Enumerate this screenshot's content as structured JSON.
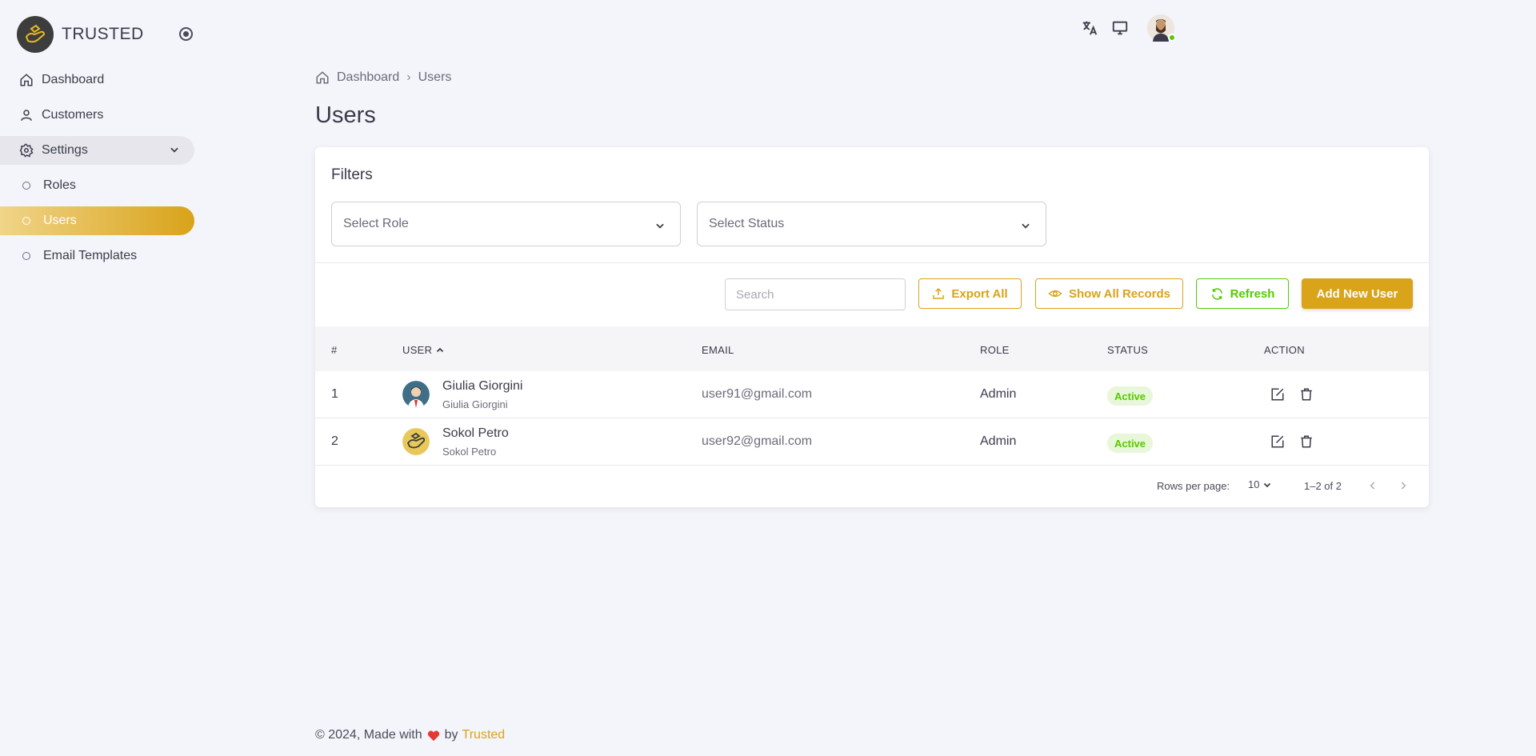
{
  "brand": {
    "name": "TRUSTED"
  },
  "sidebar": {
    "items": [
      {
        "label": "Dashboard",
        "icon": "home-icon"
      },
      {
        "label": "Customers",
        "icon": "user-icon"
      },
      {
        "label": "Settings",
        "icon": "gear-icon"
      }
    ],
    "sub_items": [
      {
        "label": "Roles"
      },
      {
        "label": "Users"
      },
      {
        "label": "Email Templates"
      }
    ]
  },
  "breadcrumb": {
    "home": "Dashboard",
    "separator": "›",
    "current": "Users"
  },
  "page": {
    "title": "Users"
  },
  "filters": {
    "title": "Filters",
    "role_placeholder": "Select Role",
    "status_placeholder": "Select Status"
  },
  "toolbar": {
    "search_placeholder": "Search",
    "export_label": "Export All",
    "show_all_label": "Show All Records",
    "refresh_label": "Refresh",
    "add_label": "Add New User"
  },
  "table": {
    "headers": {
      "num": "#",
      "user": "USER",
      "email": "EMAIL",
      "role": "ROLE",
      "status": "STATUS",
      "action": "ACTION"
    },
    "rows": [
      {
        "num": "1",
        "name": "Giulia Giorgini",
        "sub": "Giulia Giorgini",
        "email": "user91@gmail.com",
        "role": "Admin",
        "status": "Active"
      },
      {
        "num": "2",
        "name": "Sokol Petro",
        "sub": "Sokol Petro",
        "email": "user92@gmail.com",
        "role": "Admin",
        "status": "Active"
      }
    ]
  },
  "pagination": {
    "rows_label": "Rows per page:",
    "rows_value": "10",
    "range": "1–2 of 2"
  },
  "footer": {
    "text": "© 2024, Made with",
    "by": "by",
    "link": "Trusted"
  },
  "colors": {
    "accent": "#d9a31a",
    "success": "#56ca00",
    "background": "#f4f5fa"
  }
}
